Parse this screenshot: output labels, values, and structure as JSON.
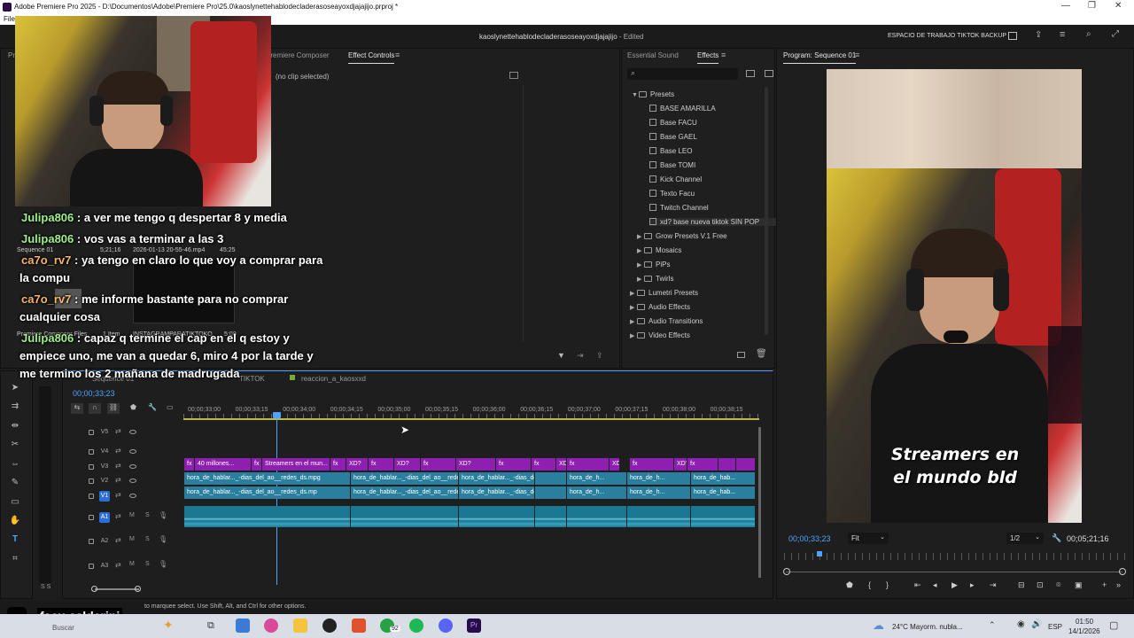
{
  "window": {
    "title": "Adobe Premiere Pro 2025 - D:\\Documentos\\Adobe\\Premiere Pro\\25.0\\kaoslynettehablodecladerasoseayoxdjajajijo.prproj *",
    "menu_first": "File"
  },
  "header": {
    "project_name": "kaoslynettehablodecladerasoseayoxdjajajijo",
    "edited": "- Edited",
    "workspace": "ESPACIO DE TRABAJO TIKTOK BACKUP"
  },
  "source_panel": {
    "tab_partial": "Pr",
    "tab_composer": "Premiere Composer",
    "tab_effect_controls": "Effect Controls",
    "no_clip": "(no clip selected)"
  },
  "project_bin": {
    "sequence_name": "Sequence 01",
    "duration_1": "5;21;16",
    "file_date": "2026-01-13 20-55-46.mp4",
    "duration_2": "45:25",
    "bin_label": "Premiere Composer Files",
    "bin_items": "1 Item",
    "bin2_label": "INSTAGRAMPARATIKTOKO",
    "bin2_duration": "5:00"
  },
  "effects_panel": {
    "tab_essential": "Essential Sound",
    "tab_effects": "Effects",
    "presets_folder": "Presets",
    "items": [
      {
        "label": "BASE AMARILLA",
        "kind": "preset"
      },
      {
        "label": "Base FACU",
        "kind": "preset"
      },
      {
        "label": "Base GAEL",
        "kind": "preset"
      },
      {
        "label": "Base LEO",
        "kind": "preset"
      },
      {
        "label": "Base TOMI",
        "kind": "preset"
      },
      {
        "label": "Kick Channel",
        "kind": "preset"
      },
      {
        "label": "Texto Facu",
        "kind": "preset"
      },
      {
        "label": "Twitch Channel",
        "kind": "preset"
      },
      {
        "label": "xd? base nueva tiktok SIN POP",
        "kind": "preset"
      },
      {
        "label": "Grow Presets V.1 Free",
        "kind": "folder"
      },
      {
        "label": "Mosaics",
        "kind": "folder"
      },
      {
        "label": "PiPs",
        "kind": "folder"
      },
      {
        "label": "Twirls",
        "kind": "folder"
      },
      {
        "label": "Lumetri Presets",
        "kind": "topfolder"
      },
      {
        "label": "Audio Effects",
        "kind": "topfolder"
      },
      {
        "label": "Audio Transitions",
        "kind": "topfolder"
      },
      {
        "label": "Video Effects",
        "kind": "topfolder"
      }
    ]
  },
  "program_monitor": {
    "title": "Program: Sequence 01",
    "timecode": "00;00;33;23",
    "fit": "Fit",
    "resolution": "1/2",
    "duration": "00;05;21;16",
    "caption_line1": "Streamers en",
    "caption_line2": "el mundo bld"
  },
  "timeline": {
    "tab1": "Sequence 01",
    "tab2": "TIKTOK",
    "tab3": "reaccion_a_kaosxxd",
    "timecode": "00;00;33;23",
    "ruler": [
      "00;00;33;00",
      "00;00;33;15",
      "00;00;34;00",
      "00;00;34;15",
      "00;00;35;00",
      "00;00;35;15",
      "00;00;36;00",
      "00;00;36;15",
      "00;00;37;00",
      "00;00;37;15",
      "00;00;38;00",
      "00;00;38;15"
    ],
    "tracks": [
      "V5",
      "V4",
      "V3",
      "V2",
      "V1",
      "A1",
      "A2",
      "A3"
    ],
    "v3_clips": [
      "fx",
      "40 millones...",
      "fx",
      "Streamers en el mun...",
      "fx",
      "XD?",
      "fx",
      "XD?",
      "fx",
      "XD?",
      "fx",
      "fx",
      "XD?",
      "fx",
      "XD?",
      "fx",
      "XD?",
      "fx"
    ],
    "v2_clip": "hora_de_hablar..._-dias_del_ao__redes_ds.mpg",
    "v1_clip": "hora_de_hablar..._-dias_del_ao__redes_ds.mp",
    "short_clip": "hora_de_h...",
    "hab_clip": "hora_de_hab...",
    "s_label": "S S"
  },
  "status_bar": {
    "hint": "to marquee select. Use Shift, Alt, and Ctrl for other options."
  },
  "chat": [
    {
      "user": "Julipa806",
      "msg": ": a ver me tengo q despertar 8 y media",
      "color": "#9ff08a"
    },
    {
      "user": "Julipa806",
      "msg": ": vos vas a terminar a las 3",
      "color": "#9ff08a"
    },
    {
      "user": "ca7o_rv7",
      "msg": ": ya tengo en claro lo que voy a comprar para",
      "color": "#f5b56a"
    },
    {
      "user": "",
      "msg": "la compu",
      "color": "#fff"
    },
    {
      "user": "ca7o_rv7",
      "msg": ": me informe bastante para no comprar",
      "color": "#f5b56a"
    },
    {
      "user": "",
      "msg": "cualquier cosa",
      "color": "#fff"
    },
    {
      "user": "Julipa806",
      "msg": ": capaz q termine el cap en el q estoy y",
      "color": "#9ff08a"
    },
    {
      "user": "",
      "msg": "empiece uno, me van a quedar 6, miro 4 por la tarde y",
      "color": "#fff"
    },
    {
      "user": "",
      "msg": "me termino los 2 mañana de madrugada",
      "color": "#fff"
    }
  ],
  "watermark": "facu.calderini",
  "taskbar": {
    "search": "Buscar",
    "badge": "92",
    "weather": "24°C  Mayorm. nubla...",
    "lang": "ESP",
    "time": "01:50",
    "date": "14/1/2026"
  }
}
